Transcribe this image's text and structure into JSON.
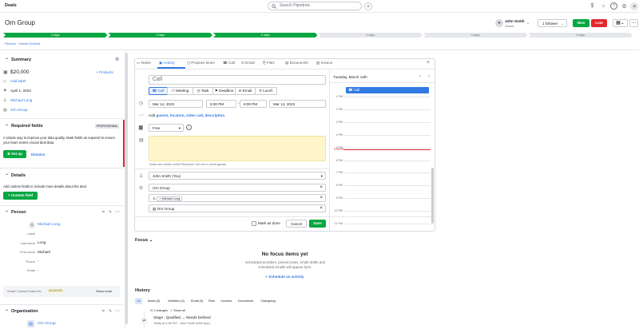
{
  "topbar": {
    "title": "Deals",
    "search_placeholder": "Search Pipedrive"
  },
  "header": {
    "deal_title": "Orn Group",
    "owner_name": "John Smith",
    "owner_role": "Owner",
    "follower_label": "1 follower",
    "won_label": "Won",
    "lost_label": "Lost"
  },
  "stages": [
    {
      "label": "0 days",
      "active": true
    },
    {
      "label": "0 days",
      "active": true
    },
    {
      "label": "0 days",
      "active": true
    },
    {
      "label": "0 days",
      "active": false
    },
    {
      "label": "0 days",
      "active": false
    },
    {
      "label": "0 days",
      "active": false
    }
  ],
  "breadcrumb": {
    "pipeline": "Pipeline",
    "stage": "Needs Defined"
  },
  "summary": {
    "title": "Summary",
    "value": "$20,000",
    "products_label": "Products",
    "add_label": "Add label",
    "date": "April 1, 2023",
    "person": "Michael Long",
    "org": "Orn Group"
  },
  "required_fields": {
    "title": "Required fields",
    "badge": "PROFESSIONAL",
    "text": "A simple way to improve your data quality. Mark fields as required to ensure your team enters crucial deal data.",
    "setup_label": "Set up",
    "dismiss_label": "Dismiss"
  },
  "details": {
    "title": "Details",
    "text": "Add custom fields to include more details about the deal",
    "button": "Custom field"
  },
  "person": {
    "title": "Person",
    "name": "Michael Long",
    "fields": [
      {
        "label": "Label",
        "value": ""
      },
      {
        "label": "Last name",
        "value": "Long"
      },
      {
        "label": "First name",
        "value": "Michael"
      },
      {
        "label": "Phone",
        "value": "-"
      },
      {
        "label": "Email",
        "value": "-"
      }
    ],
    "smart_label": "Smart Contact Data info",
    "smart_badge": "ADVANCED",
    "show_more": "Show more"
  },
  "organization": {
    "title": "Organization",
    "name": "Orn Group"
  },
  "tabs": [
    {
      "label": "Notes"
    },
    {
      "label": "Activity",
      "active": true
    },
    {
      "label": "Propose times"
    },
    {
      "label": "Call"
    },
    {
      "label": "Email"
    },
    {
      "label": "Files"
    },
    {
      "label": "Documents"
    },
    {
      "label": "Invoice"
    }
  ],
  "activity": {
    "subject_placeholder": "Call",
    "types": [
      "Call",
      "Meeting",
      "Task",
      "Deadline",
      "Email",
      "Lunch"
    ],
    "date_start": "Mar 14, 2023",
    "time_start": "6:00 PM",
    "time_end": "6:00 PM",
    "date_end": "Mar 14, 2023",
    "add_link_prefix": "Add",
    "add_link": "guests, location, video call, description",
    "priority": "Free",
    "notes_hint": "Notes are visible within Pipedrive, but not to event guests",
    "assignee": "John Smith (You)",
    "deal_link": "Orn Group",
    "person_chip": "Michael Long",
    "org_link": "Orn Group",
    "mark_done": "Mark as done",
    "cancel_label": "Cancel",
    "save_label": "Save"
  },
  "calendar": {
    "date": "Tuesday, March 14th",
    "event": "Call",
    "times": [
      "1 PM",
      "2 PM",
      "3 PM",
      "4 PM",
      "5 PM",
      "6 PM",
      "7 PM",
      "8 PM",
      "9 PM",
      "10 PM",
      "11 PM"
    ],
    "now_label": "5:05 PM"
  },
  "focus": {
    "title": "Focus",
    "empty_title": "No focus items yet",
    "empty_text": "Scheduled activities, pinned notes, email drafts and scheduled emails will appear here.",
    "schedule_link": "Schedule an activity"
  },
  "history": {
    "title": "History",
    "tabs": [
      "All",
      "Notes (0)",
      "Activities (0)",
      "Email (0)",
      "Files",
      "Invoices",
      "Documents",
      "Changelog"
    ],
    "filter1": "2 changes",
    "filter2": "Show all",
    "entry_title": "Stage : Qualified → Needs Defined",
    "entry_meta": "Today at 4:58 PM · John Smith (Web App)"
  }
}
